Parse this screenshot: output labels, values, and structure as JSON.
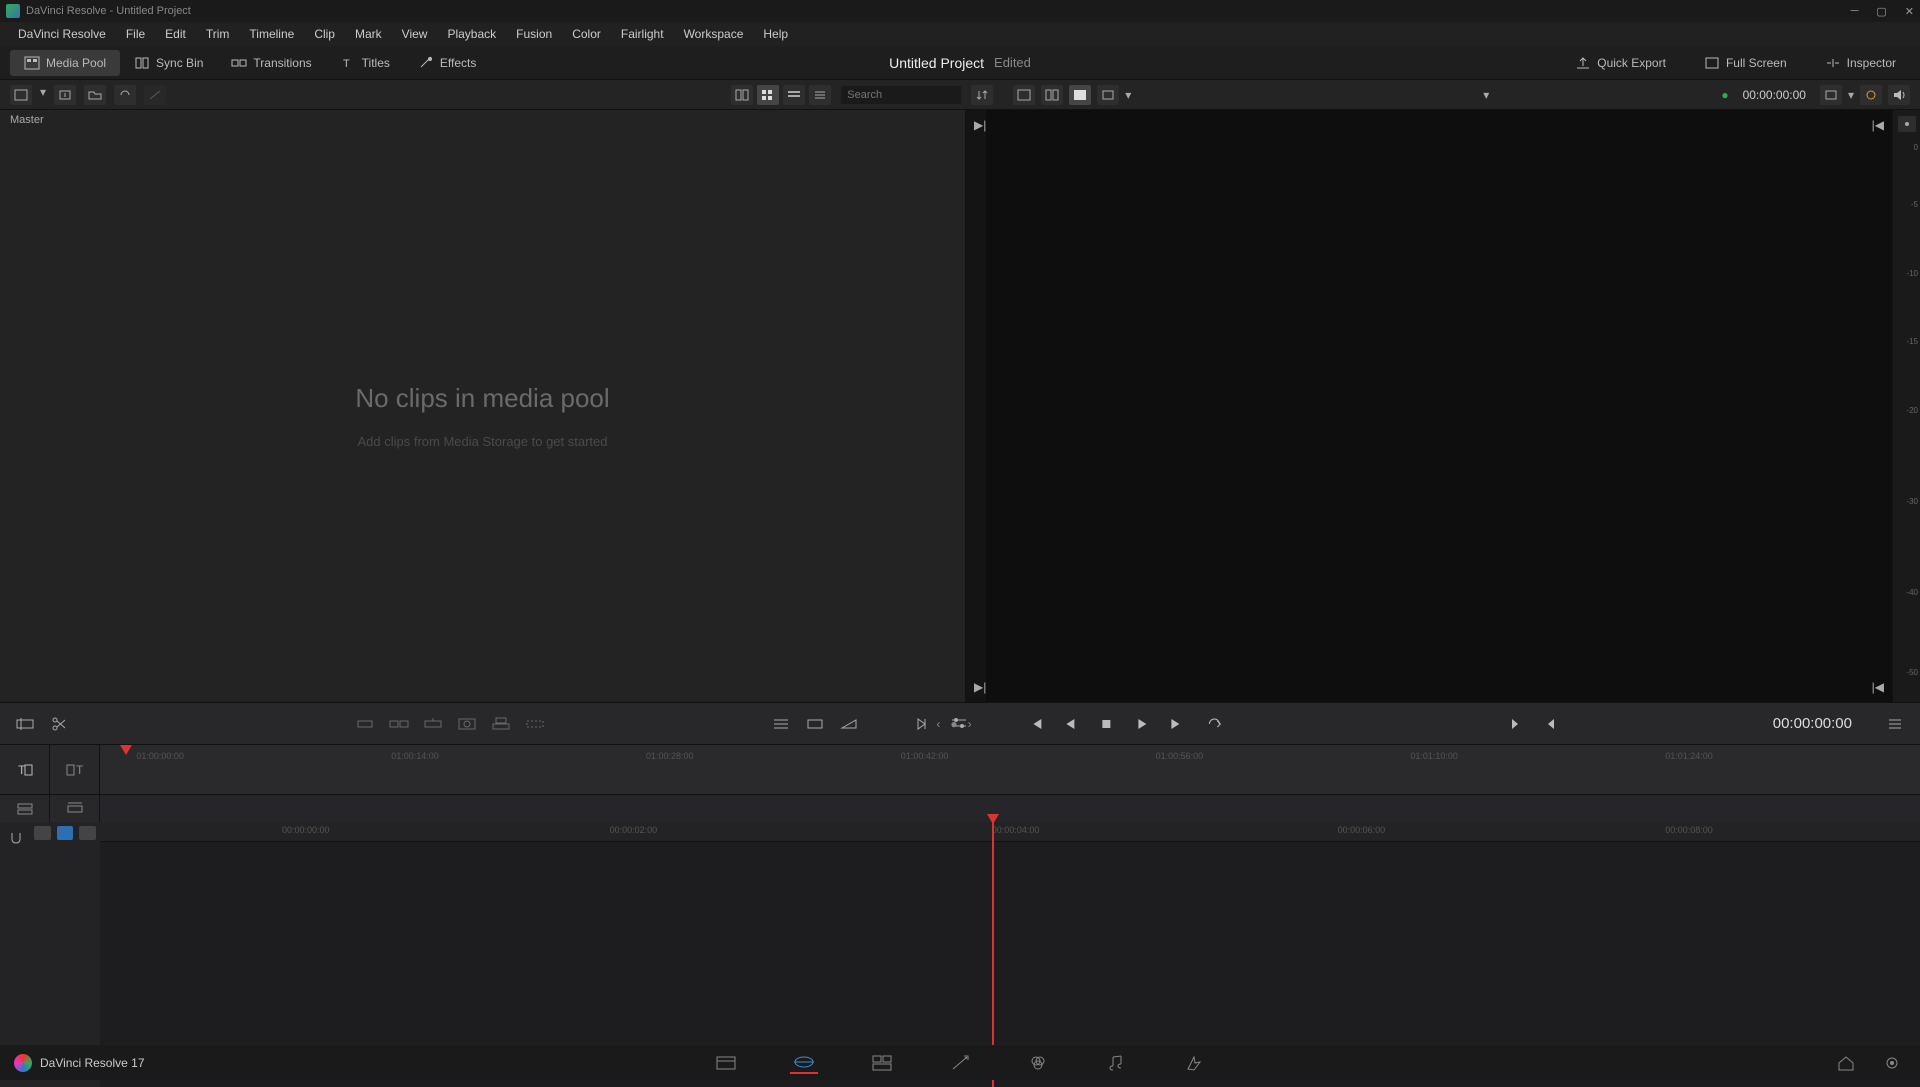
{
  "titlebar": {
    "text": "DaVinci Resolve - Untitled Project"
  },
  "menu": [
    "DaVinci Resolve",
    "File",
    "Edit",
    "Trim",
    "Timeline",
    "Clip",
    "Mark",
    "View",
    "Playback",
    "Fusion",
    "Color",
    "Fairlight",
    "Workspace",
    "Help"
  ],
  "toolTabs": {
    "items": [
      {
        "label": "Media Pool",
        "active": true
      },
      {
        "label": "Sync Bin",
        "active": false
      },
      {
        "label": "Transitions",
        "active": false
      },
      {
        "label": "Titles",
        "active": false
      },
      {
        "label": "Effects",
        "active": false
      }
    ]
  },
  "project": {
    "title": "Untitled Project",
    "status": "Edited"
  },
  "toolRight": {
    "quickExport": "Quick Export",
    "fullScreen": "Full Screen",
    "inspector": "Inspector"
  },
  "subbar": {
    "searchPlaceholder": "Search",
    "timecodeTop": "00:00:00:00"
  },
  "mediaPool": {
    "header": "Master",
    "emptyTitle": "No clips in media pool",
    "emptySub": "Add clips from Media Storage to get started"
  },
  "audioMeter": {
    "ticks": [
      "0",
      "-5",
      "-10",
      "-15",
      "-20",
      "-30",
      "-40",
      "-50"
    ]
  },
  "transport": {
    "timecode": "00:00:00:00"
  },
  "ruler": {
    "ticks": [
      "01:00:00:00",
      "01:00:14:00",
      "01:00:28:00",
      "01:00:42:00",
      "01:00:56:00",
      "01:01:10:00",
      "01:01:24:00"
    ]
  },
  "ruler2": {
    "ticks": [
      "00:00:00:00",
      "00:00:02:00",
      "00:00:04:00",
      "00:00:06:00",
      "00:00:08:00"
    ]
  },
  "pagebar": {
    "appName": "DaVinci Resolve 17"
  },
  "colors": {
    "accent": "#d33",
    "bg": "#1b1b1b"
  }
}
